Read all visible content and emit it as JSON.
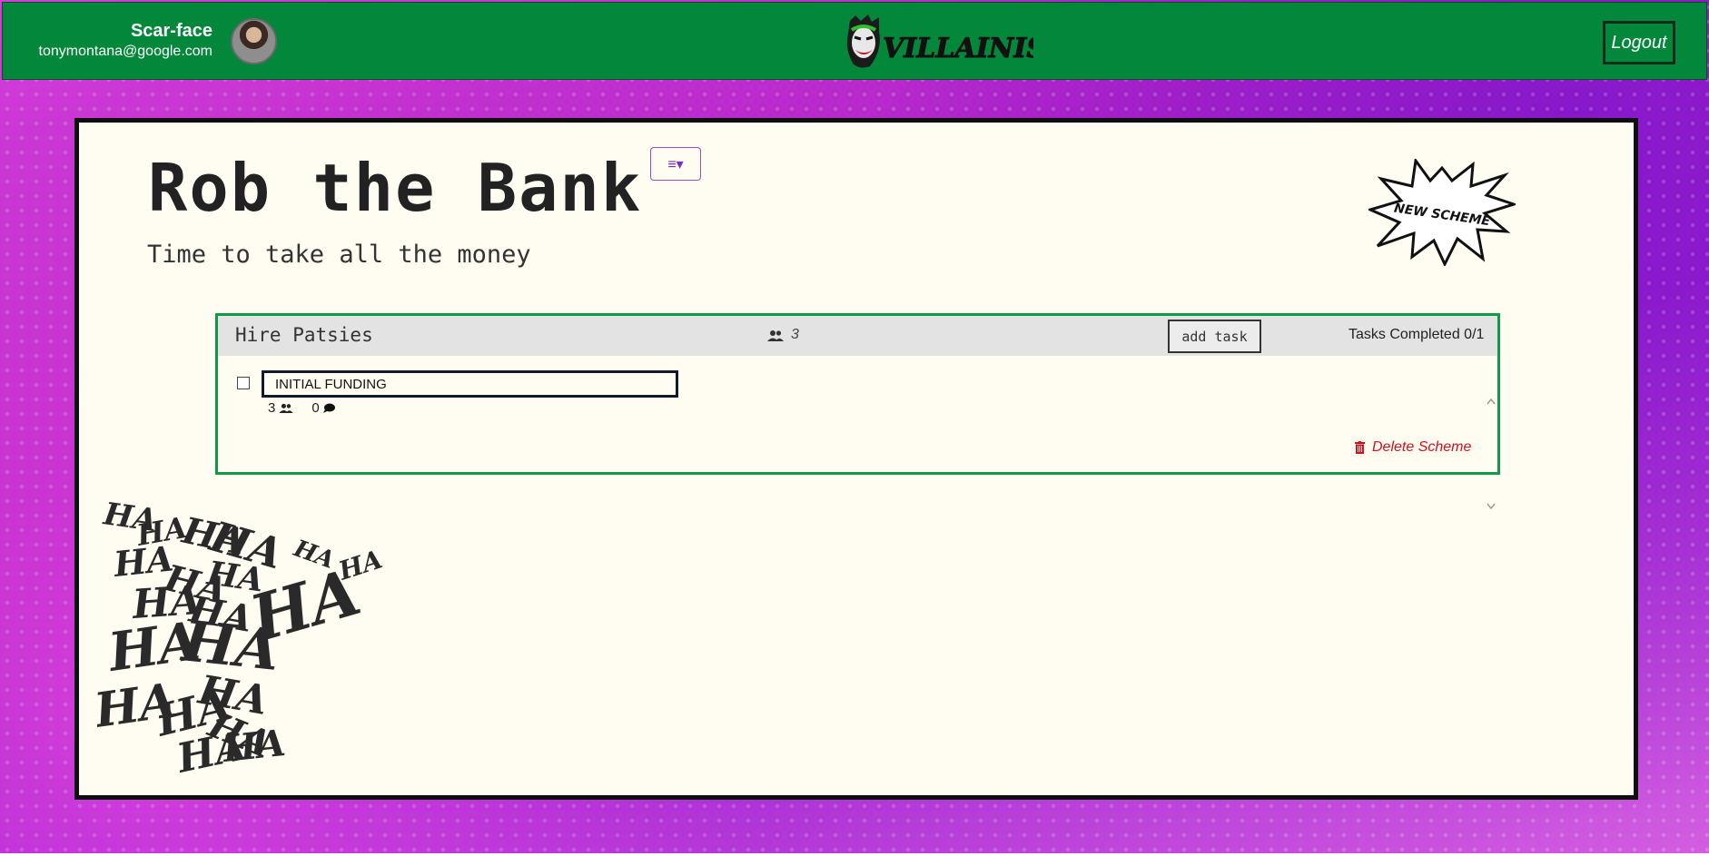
{
  "header": {
    "user_name": "Scar-face",
    "user_email": "tonymontana@google.com",
    "logo_text": "VILLAINISM",
    "logout_label": "Logout"
  },
  "page": {
    "title": "Rob the Bank",
    "subtitle": "Time to take all the money",
    "menu_icon": "hamburger-dropdown-icon",
    "new_scheme_label": "NEW SCHEME",
    "decoration_text": "HA"
  },
  "scheme": {
    "title": "Hire Patsies",
    "member_count": "3",
    "add_task_label": "add task",
    "tasks_completed": "Tasks Completed 0/1",
    "tasks": [
      {
        "name": "INITIAL FUNDING",
        "member_count": "3",
        "comment_count": "0",
        "checked": false
      }
    ],
    "delete_label": "Delete Scheme"
  },
  "colors": {
    "header_green": "#03873b",
    "card_border": "#0f9a47",
    "panel_bg": "#fffcf2",
    "delete_red": "#d0121c",
    "menu_purple": "#9a49d6"
  }
}
